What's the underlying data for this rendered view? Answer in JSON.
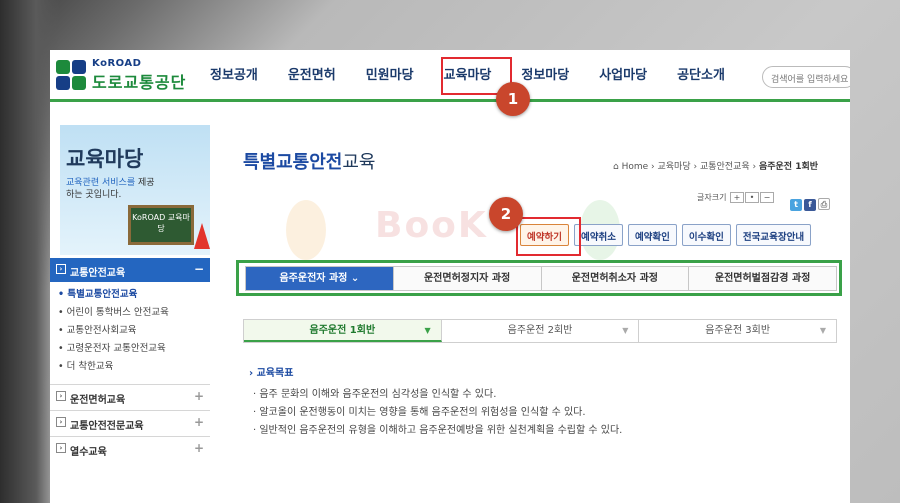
{
  "logo": {
    "en": "KoROAD",
    "kr": "도로교통공단"
  },
  "gnb": [
    {
      "label": "정보공개"
    },
    {
      "label": "운전면허"
    },
    {
      "label": "민원마당"
    },
    {
      "label": "교육마당"
    },
    {
      "label": "정보마당"
    },
    {
      "label": "사업마당"
    },
    {
      "label": "공단소개"
    }
  ],
  "search": {
    "placeholder": "검색어를 입력하세요"
  },
  "markers": {
    "first": "1",
    "second": "2"
  },
  "sidebar": {
    "title": "교육마당",
    "sub_highlight": "교육관련 서비스를",
    "sub_rest1": " 제공",
    "sub_rest2": "하는 곳입니다.",
    "board": "KoROAD 교육마당",
    "section": "교통안전교육",
    "items": [
      "특별교통안전교육",
      "어린이 통학버스 안전교육",
      "교통안전사회교육",
      "고령운전자 교통안전교육",
      "더 착한교육"
    ],
    "sections": [
      "운전면허교육",
      "교통안전전문교육",
      "열수교육"
    ]
  },
  "main": {
    "title_strong": "특별교통안전",
    "title_rest": "교육",
    "breadcrumb": {
      "home": "Home",
      "b1": "교육마당",
      "b2": "교통안전교육",
      "current": "음주운전 1회반"
    },
    "fontsize_label": "글자크기",
    "watermark": "BooK",
    "buttons": [
      "예약하기",
      "예약취소",
      "예약확인",
      "이수확인",
      "전국교육장안내"
    ],
    "tabs": [
      "음주운전자 과정",
      "운전면허정지자 과정",
      "운전면허취소자 과정",
      "운전면허벌점감경 과정"
    ],
    "rounds": [
      "음주운전 1회반",
      "음주운전 2회반",
      "음주운전 3회반"
    ],
    "goal_title": "교육목표",
    "goals": [
      "음주 문화의 이해와 음주운전의 심각성을 인식할 수 있다.",
      "알코올이 운전행동이 미치는 영향을 통해 음주운전의 위험성을 인식할 수 있다.",
      "일반적인 음주운전의 유형을 이해하고 음주운전예방을 위한 실천계획을 수립할 수 있다."
    ]
  },
  "colors": {
    "brand_green": "#3aa148",
    "brand_blue": "#2466c0",
    "highlight_red": "#e22a30",
    "marker": "#c9462c"
  }
}
